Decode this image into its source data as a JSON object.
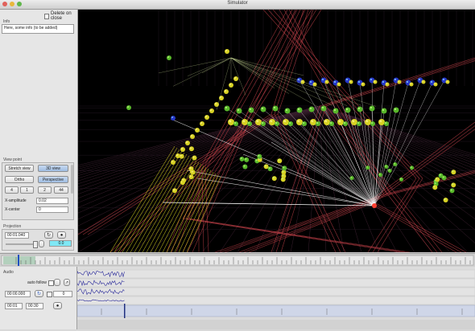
{
  "window": {
    "title": "Simulator"
  },
  "sidebar": {
    "delete_on_close": "Delete on close",
    "info_label": "Info",
    "info_text": "Here, some info (to be added)",
    "viewpoint": {
      "label": "View point",
      "stretch_view": "Stretch view",
      "view_3d": "3D view",
      "ortho": "Ortho",
      "perspective": "Perspective",
      "btn_4": "4",
      "btn_1": "1",
      "btn_2": "2",
      "btn_44": "44",
      "x_amplitude_label": "X-amplitude",
      "x_amplitude_value": "0.02",
      "x_center_label": "X-center",
      "x_center_value": "0"
    },
    "projection": {
      "label": "Projection",
      "time_value": "00:01.040",
      "slider_value": "0.0"
    }
  },
  "audio": {
    "label": "Audio",
    "auto_follow": "auto follow",
    "time_value": "00:00.000",
    "counter_value": "0",
    "start_value": "00:01",
    "end_value": "00:30"
  },
  "colors": {
    "viewport_bg": "#000000",
    "red_lines": "#c8434b",
    "yellow": "#d8d224",
    "green": "#58b82a",
    "blue": "#2436c8",
    "waveform": "#2a2a9a"
  }
}
